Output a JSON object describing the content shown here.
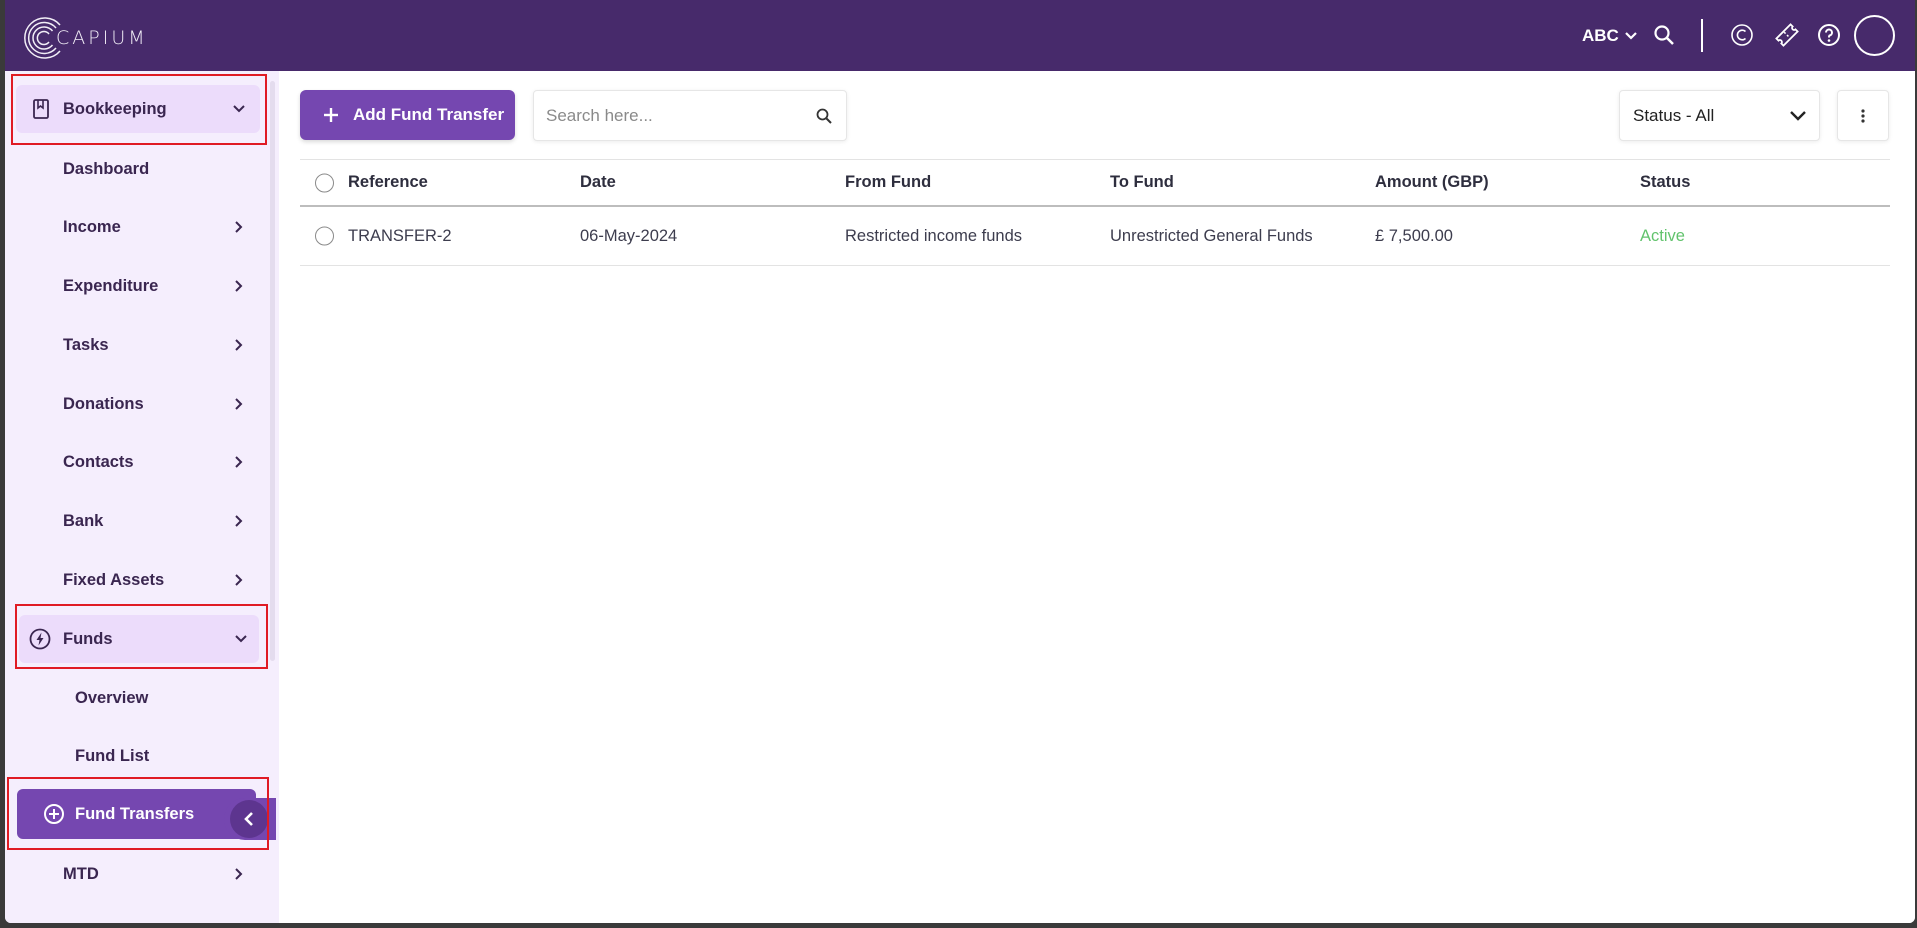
{
  "app": {
    "logo_text": "CAPIUM"
  },
  "header": {
    "org_name": "ABC"
  },
  "sidebar": {
    "items": [
      {
        "label": "Bookkeeping",
        "top": 0
      },
      {
        "label": "Dashboard"
      },
      {
        "label": "Income"
      },
      {
        "label": "Expenditure"
      },
      {
        "label": "Tasks"
      },
      {
        "label": "Donations"
      },
      {
        "label": "Contacts"
      },
      {
        "label": "Bank"
      },
      {
        "label": "Fixed Assets"
      },
      {
        "label": "Funds"
      },
      {
        "label": "Overview"
      },
      {
        "label": "Fund List"
      },
      {
        "label": "Fund Transfers"
      },
      {
        "label": "MTD"
      }
    ]
  },
  "toolbar": {
    "add_label": "Add Fund Transfer",
    "search_placeholder": "Search here...",
    "status_filter": "Status - All"
  },
  "table": {
    "columns": [
      "Reference",
      "Date",
      "From Fund",
      "To Fund",
      "Amount (GBP)",
      "Status"
    ],
    "rows": [
      {
        "reference": "TRANSFER-2",
        "date": "06-May-2024",
        "from_fund": "Restricted income funds",
        "to_fund": "Unrestricted General Funds",
        "amount": "£ 7,500.00",
        "status": "Active"
      }
    ]
  },
  "colors": {
    "header_bg": "#472a6b",
    "accent": "#7547b0",
    "sidebar_bg": "#f5eefd",
    "section_bg": "#ecdcfb",
    "status_active": "#62c36d",
    "highlight_border": "#e01b24"
  }
}
